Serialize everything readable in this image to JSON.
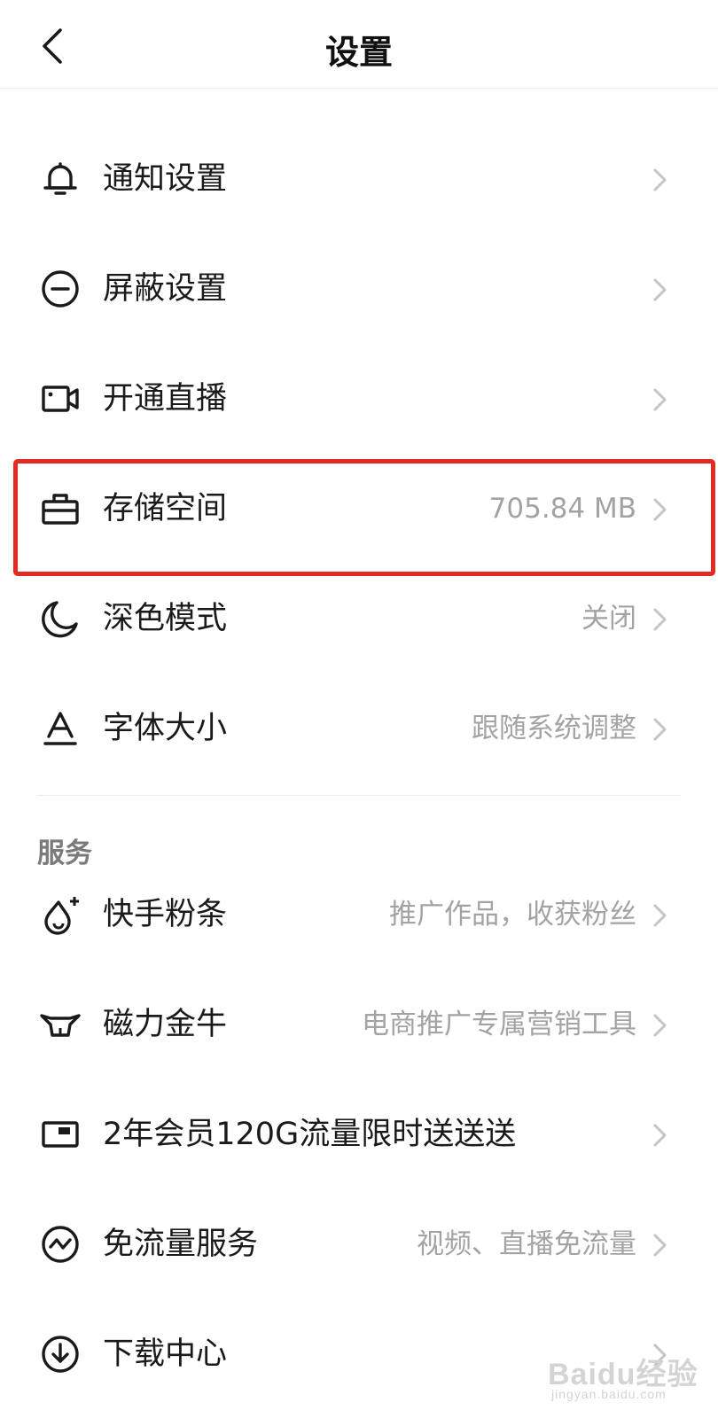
{
  "header": {
    "title": "设置",
    "back_icon": "chevron-left-icon"
  },
  "settings": [
    {
      "icon": "bell-icon",
      "label": "通知设置",
      "value": ""
    },
    {
      "icon": "minus-circle-icon",
      "label": "屏蔽设置",
      "value": ""
    },
    {
      "icon": "video-camera-icon",
      "label": "开通直播",
      "value": ""
    },
    {
      "icon": "toolbox-icon",
      "label": "存储空间",
      "value": "705.84 MB"
    },
    {
      "icon": "moon-icon",
      "label": "深色模式",
      "value": "关闭"
    },
    {
      "icon": "font-size-icon",
      "label": "字体大小",
      "value": "跟随系统调整"
    }
  ],
  "services": {
    "title": "服务",
    "items": [
      {
        "icon": "flame-plus-icon",
        "label": "快手粉条",
        "value": "推广作品，收获粉丝"
      },
      {
        "icon": "bull-icon",
        "label": "磁力金牛",
        "value": "电商推广专属营销工具"
      },
      {
        "icon": "card-icon",
        "label": "2年会员120G流量限时送送送",
        "value": ""
      },
      {
        "icon": "data-free-icon",
        "label": "免流量服务",
        "value": "视频、直播免流量"
      },
      {
        "icon": "download-icon",
        "label": "下载中心",
        "value": ""
      }
    ]
  },
  "highlight": {
    "target": "存储空间",
    "color": "#e12a24"
  },
  "watermark": {
    "main": "Baidu经验",
    "sub": "jingyan.baidu.com"
  },
  "colors": {
    "text": "#1a1a1a",
    "secondary": "#a3a3a3",
    "chevron": "#c4c4c4",
    "section": "#7a7a7a"
  }
}
